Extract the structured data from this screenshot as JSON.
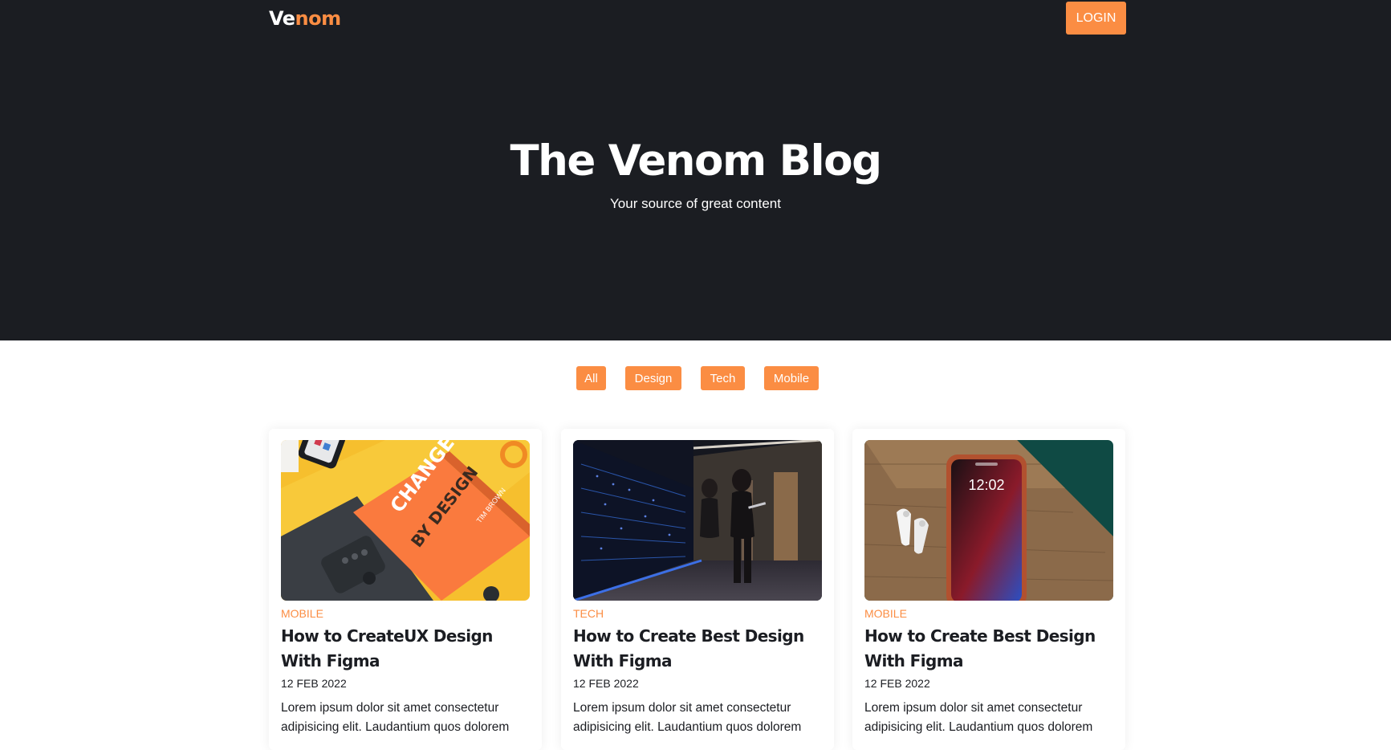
{
  "brand": {
    "logo_part1": "Ve",
    "logo_part2": "nom",
    "accent_color": "#fb8d43",
    "dark_color": "#1b1d22"
  },
  "nav": {
    "login_label": "LOGIN"
  },
  "hero": {
    "title": "The Venom Blog",
    "subtitle": "Your source of great content"
  },
  "filters": [
    "All",
    "Design",
    "Tech",
    "Mobile"
  ],
  "posts": [
    {
      "image": "change-by-design-book-photo",
      "category": "MOBILE",
      "title": "How to CreateUX Design With Figma",
      "date": "12 FEB 2022",
      "excerpt": "Lorem ipsum dolor sit amet consectetur adipisicing elit. Laudantium quos dolorem"
    },
    {
      "image": "server-room-woman-laptop-photo",
      "category": "TECH",
      "title": "How to Create Best Design With Figma",
      "date": "12 FEB 2022",
      "excerpt": "Lorem ipsum dolor sit amet consectetur adipisicing elit. Laudantium quos dolorem"
    },
    {
      "image": "iphone-airpods-on-wood-photo",
      "category": "MOBILE",
      "title": "How to Create Best Design With Figma",
      "date": "12 FEB 2022",
      "excerpt": "Lorem ipsum dolor sit amet consectetur adipisicing elit. Laudantium quos dolorem"
    }
  ],
  "image_text": {
    "book_title_1": "CHANGE",
    "book_title_2": "BY DESIGN",
    "book_author": "TIM BROWN",
    "phone_time": "12:02"
  }
}
